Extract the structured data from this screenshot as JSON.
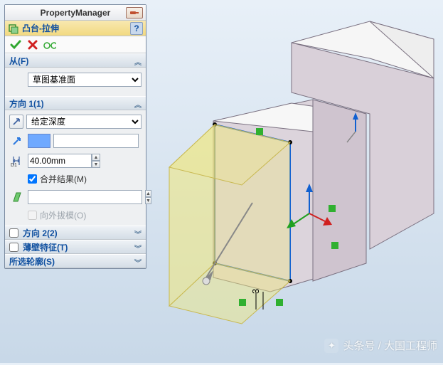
{
  "panel": {
    "title": "PropertyManager",
    "feature_name": "凸台-拉伸",
    "help_label": "?",
    "actions": {
      "ok": "✓",
      "cancel": "✕",
      "preview": "👓"
    }
  },
  "from": {
    "title": "从(F)",
    "start_condition": "草图基准面"
  },
  "dir1": {
    "title": "方向 1(1)",
    "end_condition": "给定深度",
    "selection": "",
    "depth": "40.00mm",
    "merge_label": "合并结果(M)",
    "merge_checked": true,
    "draft_selection": "",
    "draft_outward_label": "向外拔模(O)",
    "draft_outward_checked": false
  },
  "dir2": {
    "title": "方向 2(2)",
    "enabled": false
  },
  "thin": {
    "title": "薄壁特征(T)",
    "enabled": false
  },
  "contours": {
    "title": "所选轮廓(S)"
  },
  "watermark": {
    "text": "头条号 / 大国工程师"
  },
  "model": {
    "dim_label": "3"
  }
}
